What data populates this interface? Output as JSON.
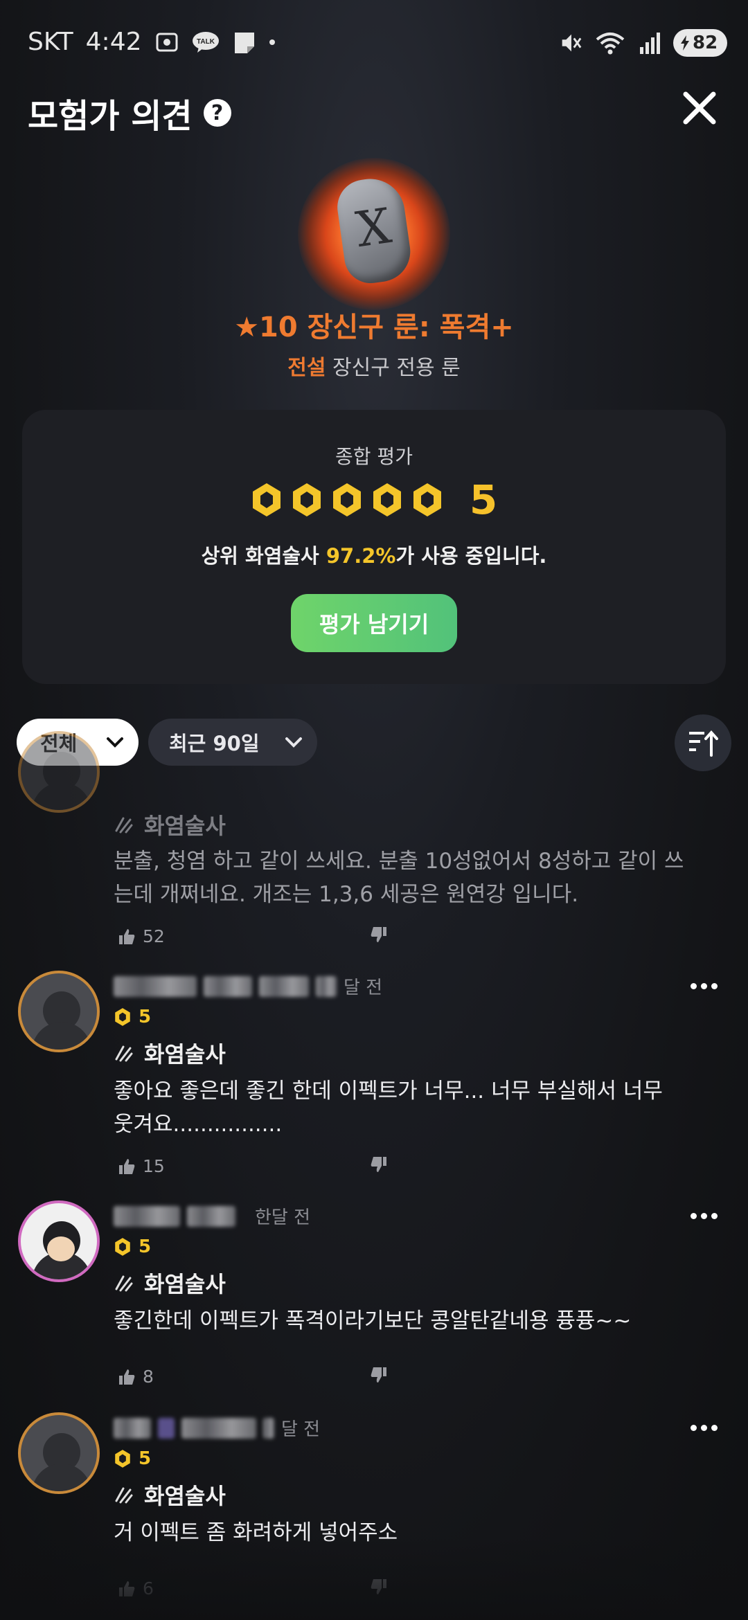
{
  "status_bar": {
    "carrier": "SKT",
    "time": "4:42",
    "talk_badge": "TALK",
    "battery": "82"
  },
  "header": {
    "title": "모험가 의견",
    "help_glyph": "?"
  },
  "item": {
    "name": "★10 장신구 룬: 폭격+",
    "grade": "전설",
    "type": "장신구 전용 룬",
    "rune_glyph": "X"
  },
  "summary": {
    "label": "종합 평가",
    "score": "5",
    "usage_prefix": "상위 화염술사 ",
    "usage_pct": "97.2%",
    "usage_suffix": "가 사용 중입니다.",
    "button": "평가 남기기"
  },
  "filters": {
    "category": "전체",
    "period": "최근 90일"
  },
  "reviews": [
    {
      "class": "화염술사",
      "text": "분출, 청염 하고 같이 쓰세요. 분출 10성없어서 8성하고 같이 쓰는데 개쩌네요. 개조는 1,3,6 세공은 원연강 입니다.",
      "likes": "52"
    },
    {
      "time": "달 전",
      "rating": "5",
      "class": "화염술사",
      "text": "좋아요 좋은데 좋긴 한데 이펙트가 너무... 너무 부실해서 너무 웃겨요................",
      "likes": "15"
    },
    {
      "time": "한달 전",
      "rating": "5",
      "class": "화염술사",
      "text": "좋긴한데 이펙트가 폭격이라기보단 콩알탄같네용 퓽퓽~~",
      "likes": "8"
    },
    {
      "time": "달 전",
      "rating": "5",
      "class": "화염술사",
      "text": "거 이펙트 좀 화려하게 넣어주소",
      "likes": "6"
    }
  ],
  "colors": {
    "accent_orange": "#ef7b30",
    "gold": "#f4c52a",
    "button_green": "#5fcb72",
    "card_bg": "#1e1f24"
  }
}
